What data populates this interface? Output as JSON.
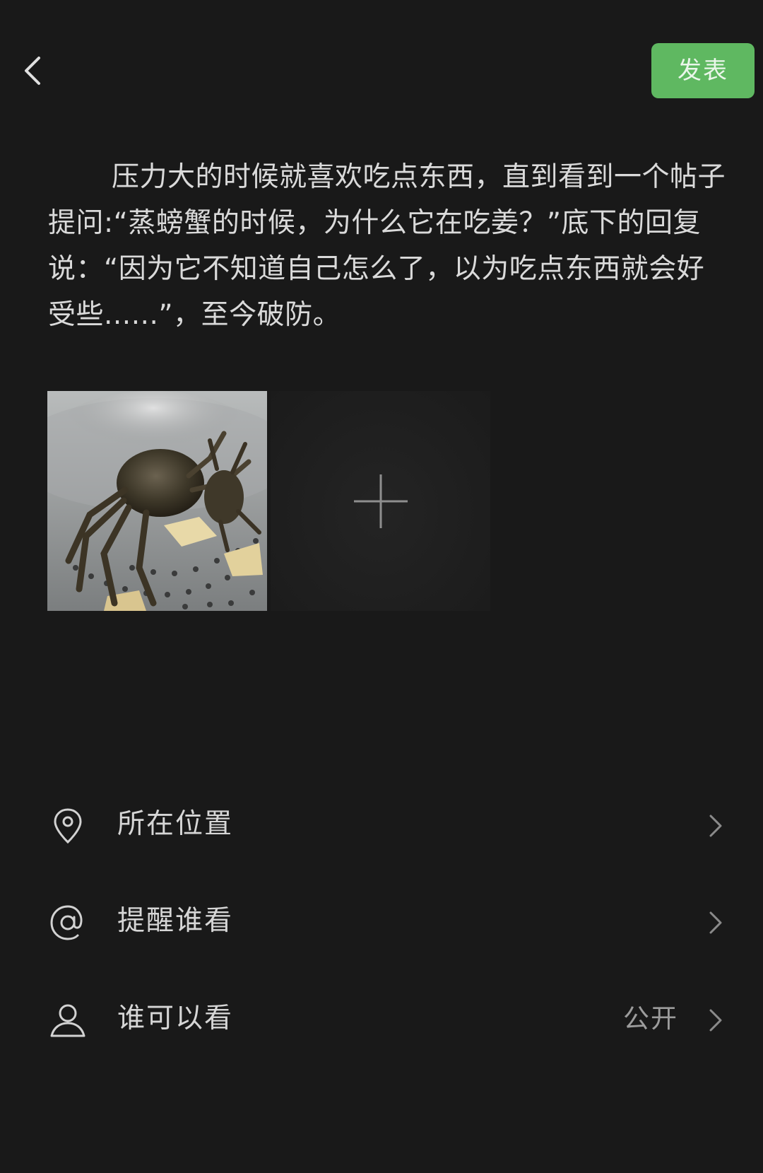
{
  "header": {
    "publish_label": "发表"
  },
  "post": {
    "text": "压力大的时候就喜欢吃点东西，直到看到一个帖子提问:“蒸螃蟹的时候，为什么它在吃姜？”底下的回复说：“因为它不知道自己怎么了，以为吃点东西就会好受些......”，至今破防。"
  },
  "media": {
    "photo_alt": "蒸螃蟹",
    "add_icon": "plus-icon"
  },
  "menu": {
    "location": {
      "label": "所在位置",
      "icon": "location-pin-icon"
    },
    "mention": {
      "label": "提醒谁看",
      "icon": "at-icon"
    },
    "visibility": {
      "label": "谁可以看",
      "value": "公开",
      "icon": "user-icon"
    }
  },
  "colors": {
    "background": "#191919",
    "publish_button": "#5fb861",
    "text": "#dadada",
    "secondary_text": "#9c9c9c"
  }
}
